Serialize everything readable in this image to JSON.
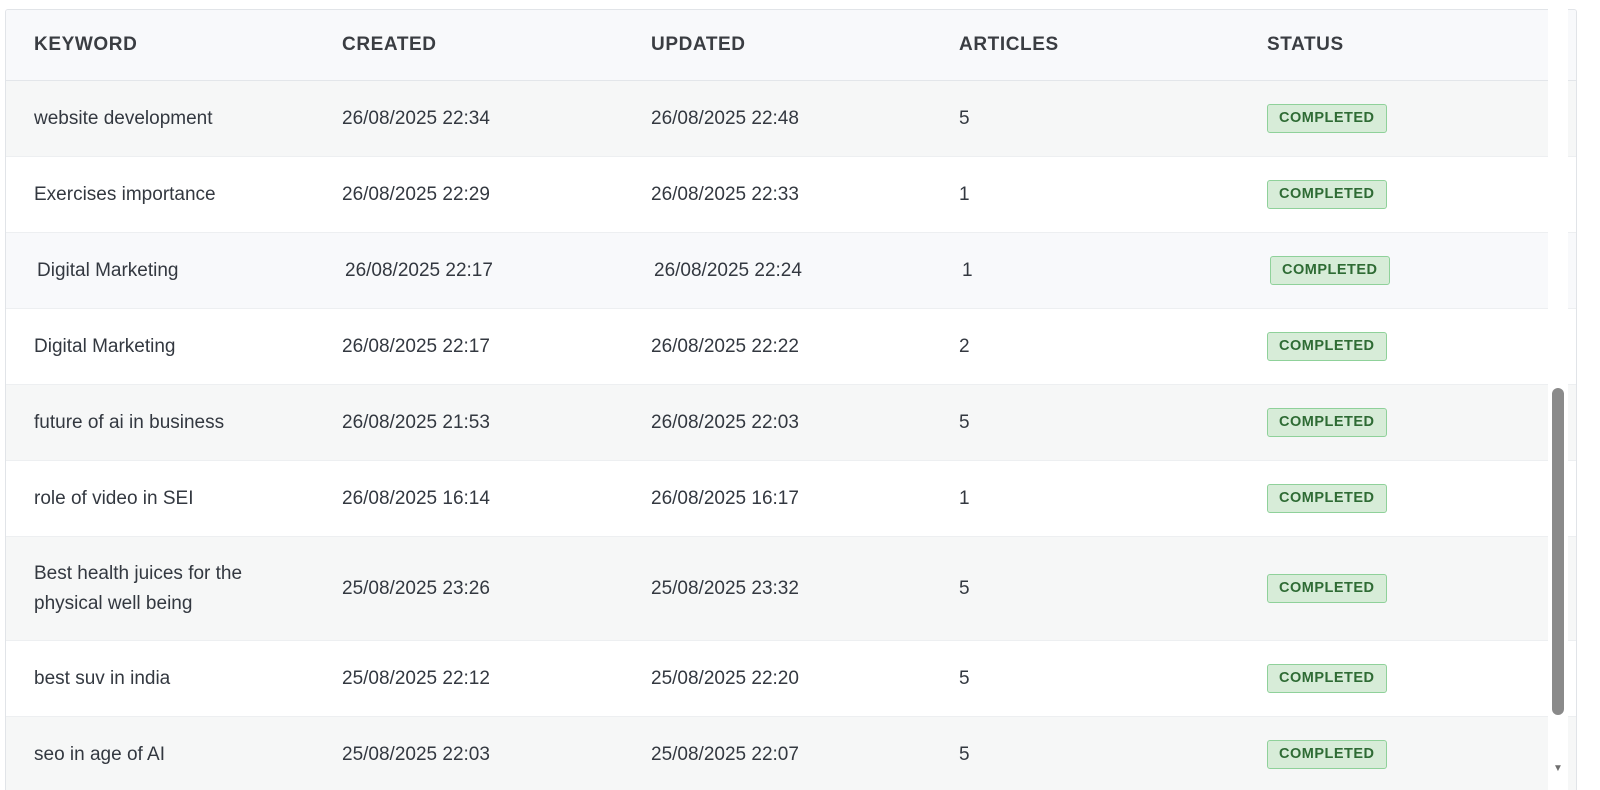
{
  "table": {
    "headers": {
      "keyword": "KEYWORD",
      "created": "CREATED",
      "updated": "UPDATED",
      "articles": "ARTICLES",
      "status": "STATUS"
    },
    "rows": [
      {
        "keyword": "website development",
        "created": "26/08/2025 22:34",
        "updated": "26/08/2025 22:48",
        "articles": "5",
        "status": "COMPLETED"
      },
      {
        "keyword": "Exercises importance",
        "created": "26/08/2025 22:29",
        "updated": "26/08/2025 22:33",
        "articles": "1",
        "status": "COMPLETED"
      },
      {
        "keyword": "Digital Marketing",
        "created": "26/08/2025 22:17",
        "updated": "26/08/2025 22:24",
        "articles": "1",
        "status": "COMPLETED"
      },
      {
        "keyword": "Digital Marketing",
        "created": "26/08/2025 22:17",
        "updated": "26/08/2025 22:22",
        "articles": "2",
        "status": "COMPLETED"
      },
      {
        "keyword": "future of ai in business",
        "created": "26/08/2025 21:53",
        "updated": "26/08/2025 22:03",
        "articles": "5",
        "status": "COMPLETED"
      },
      {
        "keyword": "role of video in SEI",
        "created": "26/08/2025 16:14",
        "updated": "26/08/2025 16:17",
        "articles": "1",
        "status": "COMPLETED"
      },
      {
        "keyword": "Best health juices for the",
        "keyword_line2": "physical well being",
        "created": "25/08/2025 23:26",
        "updated": "25/08/2025 23:32",
        "articles": "5",
        "status": "COMPLETED"
      },
      {
        "keyword": "best suv in india",
        "created": "25/08/2025 22:12",
        "updated": "25/08/2025 22:20",
        "articles": "5",
        "status": "COMPLETED"
      },
      {
        "keyword": "seo in age of AI",
        "created": "25/08/2025 22:03",
        "updated": "25/08/2025 22:07",
        "articles": "5",
        "status": "COMPLETED"
      }
    ]
  },
  "colors": {
    "header_bg": "#f8f9fb",
    "row_alt_bg": "#f6f7f7",
    "badge_bg": "#d7ecd8",
    "badge_border": "#8fd19a",
    "badge_text": "#2e6b34",
    "scroll_thumb": "#8a8a8a"
  }
}
